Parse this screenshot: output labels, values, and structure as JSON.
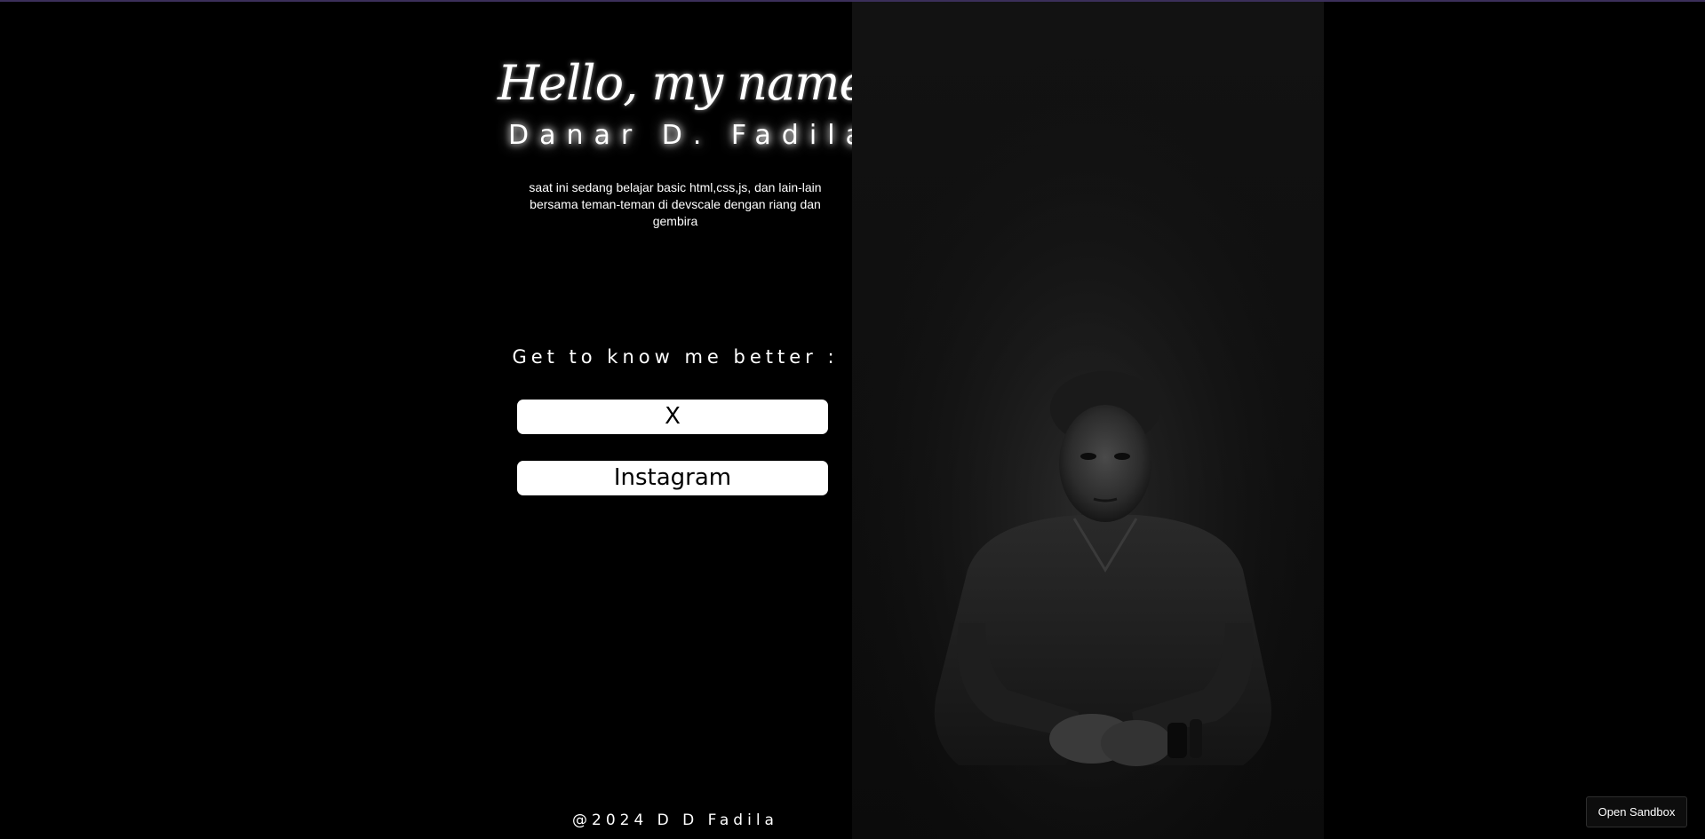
{
  "hero": {
    "greeting": "Hello, my name is",
    "name": "Danar D. Fadila",
    "bio": "saat ini sedang belajar basic html,css,js, dan lain-lain bersama teman-teman di devscale dengan riang dan gembira"
  },
  "links": {
    "heading": "Get to know me better :",
    "items": [
      {
        "label": "X"
      },
      {
        "label": "Instagram"
      }
    ]
  },
  "footer": {
    "copyright": "@2024 D D Fadila"
  },
  "sandbox": {
    "label": "Open Sandbox"
  },
  "colors": {
    "background": "#000000",
    "text": "#ffffff",
    "button_bg": "#ffffff",
    "button_text": "#000000"
  },
  "photo": {
    "icon": "portrait-photo"
  }
}
